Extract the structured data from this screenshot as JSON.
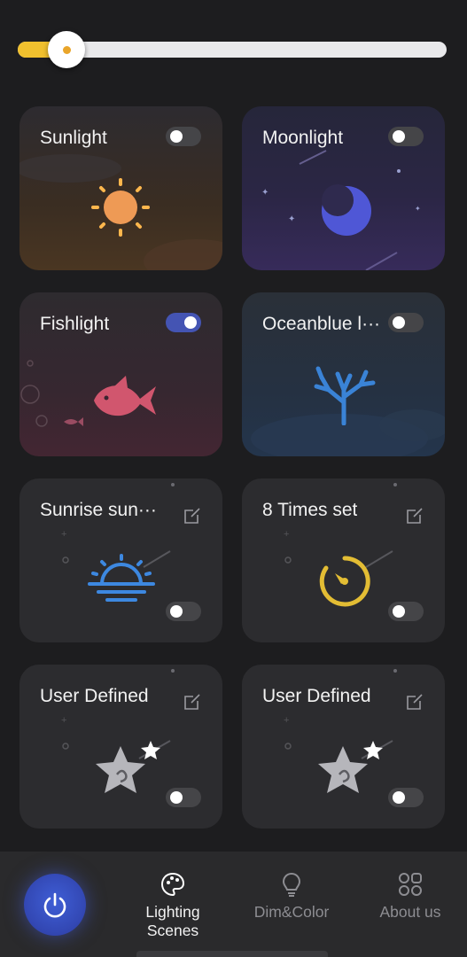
{
  "brightness_slider": {
    "value_percent": 11,
    "fill_color": "#f0c02e"
  },
  "cards": [
    {
      "title": "Sunlight",
      "toggle_on": false,
      "icon": "sun-icon"
    },
    {
      "title": "Moonlight",
      "toggle_on": false,
      "icon": "moon-icon"
    },
    {
      "title": "Fishlight",
      "toggle_on": true,
      "icon": "fish-icon"
    },
    {
      "title": "Oceanblue l···",
      "toggle_on": false,
      "icon": "coral-icon"
    },
    {
      "title": "Sunrise sun···",
      "toggle_on": false,
      "icon": "sunrise-icon",
      "has_edit": true
    },
    {
      "title": "8 Times set",
      "toggle_on": false,
      "icon": "timer-icon",
      "has_edit": true
    },
    {
      "title": "User Defined",
      "toggle_on": false,
      "icon": "star-icon",
      "has_edit": true
    },
    {
      "title": "User Defined",
      "toggle_on": false,
      "icon": "star-icon",
      "has_edit": true
    }
  ],
  "bottom_nav": {
    "power_icon": "power-icon",
    "items": [
      {
        "label_line1": "Lighting",
        "label_line2": "Scenes",
        "icon": "palette-icon",
        "active": true
      },
      {
        "label_line1": "Dim&Color",
        "icon": "bulb-icon",
        "active": false
      },
      {
        "label_line1": "About us",
        "icon": "grid-icon",
        "active": false
      }
    ]
  },
  "colors": {
    "accent_blue": "#4454b3",
    "accent_yellow": "#f0c02e",
    "background": "#1d1d1f"
  }
}
